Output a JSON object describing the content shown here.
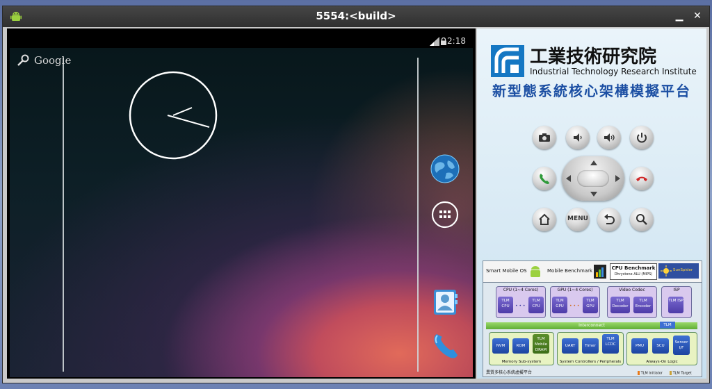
{
  "window": {
    "title": "5554:<build>",
    "controls": [
      "minimize-icon",
      "close-icon"
    ]
  },
  "android": {
    "status_bar": {
      "time": "2:18",
      "icons": [
        "signal-icon",
        "lock-icon"
      ]
    },
    "search_widget": {
      "label": "Google"
    },
    "clock": {
      "icon": "analog-clock"
    },
    "dock": [
      {
        "name": "browser",
        "icon": "globe-icon"
      },
      {
        "name": "all-apps",
        "icon": "app-grid-icon"
      },
      {
        "name": "contacts",
        "icon": "contacts-icon"
      },
      {
        "name": "phone",
        "icon": "phone-icon"
      }
    ]
  },
  "sidebar": {
    "org_name_zh": "工業技術研究院",
    "org_name_en": "Industrial Technology Research Institute",
    "platform_title": "新型態系統核心架構模擬平台",
    "remote": {
      "menu_label": "MENU",
      "buttons": [
        "camera",
        "volume-down",
        "volume-up",
        "power",
        "call",
        "end-call",
        "home",
        "menu",
        "back",
        "search"
      ]
    },
    "architecture": {
      "benchmarks": {
        "os": "Smart Mobile OS",
        "mobile": "Mobile Benchmark",
        "cpu_title": "CPU Benchmark",
        "cpu_sub": "Dhrystone ALU (MIPS)",
        "sunspider": "SunSpider"
      },
      "blocks": {
        "cpu": "CPU (1~4 Cores)",
        "gpu": "GPU (1~4 Cores)",
        "video": "Video Codec",
        "isp": "ISP"
      },
      "tiles": {
        "tlm_cpu": "TLM CPU",
        "tlm_gpu": "TLM GPU",
        "tlm_decoder": "TLM Decoder",
        "tlm_encoder": "TLM Encoder",
        "tlm_isp": "TLM ISP",
        "tlm": "TLM",
        "nvm": "NVM",
        "rom": "ROM",
        "mobile_dram": "TLM Mobile DRAM",
        "uart": "UART",
        "timer": "Timer",
        "lcdc": "TLM LCDC",
        "pmu": "PMU",
        "scu": "SCU",
        "sensor": "Sensor I/F",
        "dots": "• • •"
      },
      "interconnect": "Interconnect",
      "groups": {
        "memory": "Memory Sub-system",
        "controllers": "System Controllers / Peripherals",
        "always_on": "Always-On Logic"
      },
      "footer_zh": "異質多核心系統虛擬平台",
      "legend_initiator": "TLM Initiator",
      "legend_target": "TLM Target"
    }
  }
}
